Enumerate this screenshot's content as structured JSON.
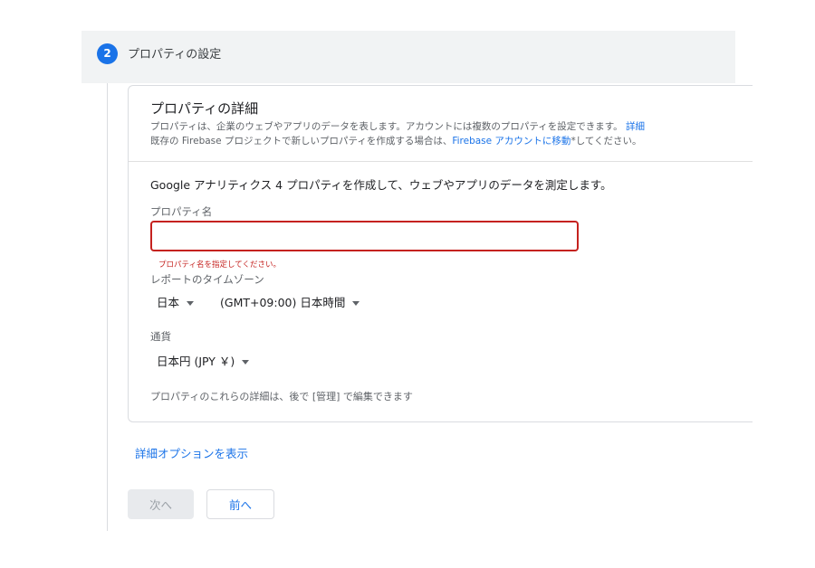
{
  "step": {
    "number": "2",
    "title": "プロパティの設定"
  },
  "card": {
    "title": "プロパティの詳細",
    "desc1_text": "プロパティは、企業のウェブやアプリのデータを表します。アカウントには複数のプロパティを設定できます。",
    "desc1_link": "詳細",
    "desc2_prefix": "既存の Firebase プロジェクトで新しいプロパティを作成する場合は、",
    "desc2_link": "Firebase アカウントに移動",
    "desc2_suffix": "*してください。"
  },
  "form": {
    "intro": "Google アナリティクス 4 プロパティを作成して、ウェブやアプリのデータを測定します。",
    "property_name": {
      "label": "プロパティ名",
      "value": "",
      "error": "プロパティ名を指定してください。"
    },
    "timezone": {
      "label": "レポートのタイムゾーン",
      "country": "日本",
      "zone": "(GMT+09:00) 日本時間"
    },
    "currency": {
      "label": "通貨",
      "value": "日本円 (JPY ￥)"
    },
    "edit_note": "プロパティのこれらの詳細は、後で [管理] で編集できます"
  },
  "advanced_link": "詳細オプションを表示",
  "buttons": {
    "next": "次へ",
    "prev": "前へ"
  },
  "colors": {
    "accent": "#1a73e8",
    "error": "#c5221f",
    "header_bg": "#f1f3f4"
  }
}
